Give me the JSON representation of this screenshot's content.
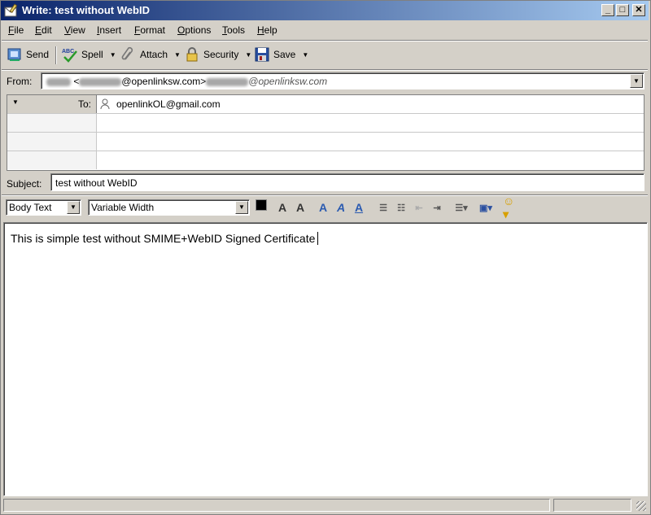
{
  "window": {
    "title": "Write: test without WebID"
  },
  "menu": [
    "File",
    "Edit",
    "View",
    "Insert",
    "Format",
    "Options",
    "Tools",
    "Help"
  ],
  "menu_underline": [
    "F",
    "E",
    "V",
    "I",
    "F",
    "O",
    "T",
    "H"
  ],
  "toolbar": {
    "send": "Send",
    "spell": "Spell",
    "attach": "Attach",
    "security": "Security",
    "save": "Save"
  },
  "from": {
    "label": "From:",
    "value_mid": "@openlinksw.com>",
    "value_right": "@openlinksw.com",
    "prefix": "<"
  },
  "recipients": [
    {
      "type": "To:",
      "address": "openlinkOL@gmail.com"
    }
  ],
  "subject": {
    "label": "Subject:",
    "value": "test without WebID"
  },
  "format": {
    "paragraph": "Body Text",
    "font": "Variable Width"
  },
  "body": {
    "text": "This is simple test without SMIME+WebID Signed Certificate"
  }
}
